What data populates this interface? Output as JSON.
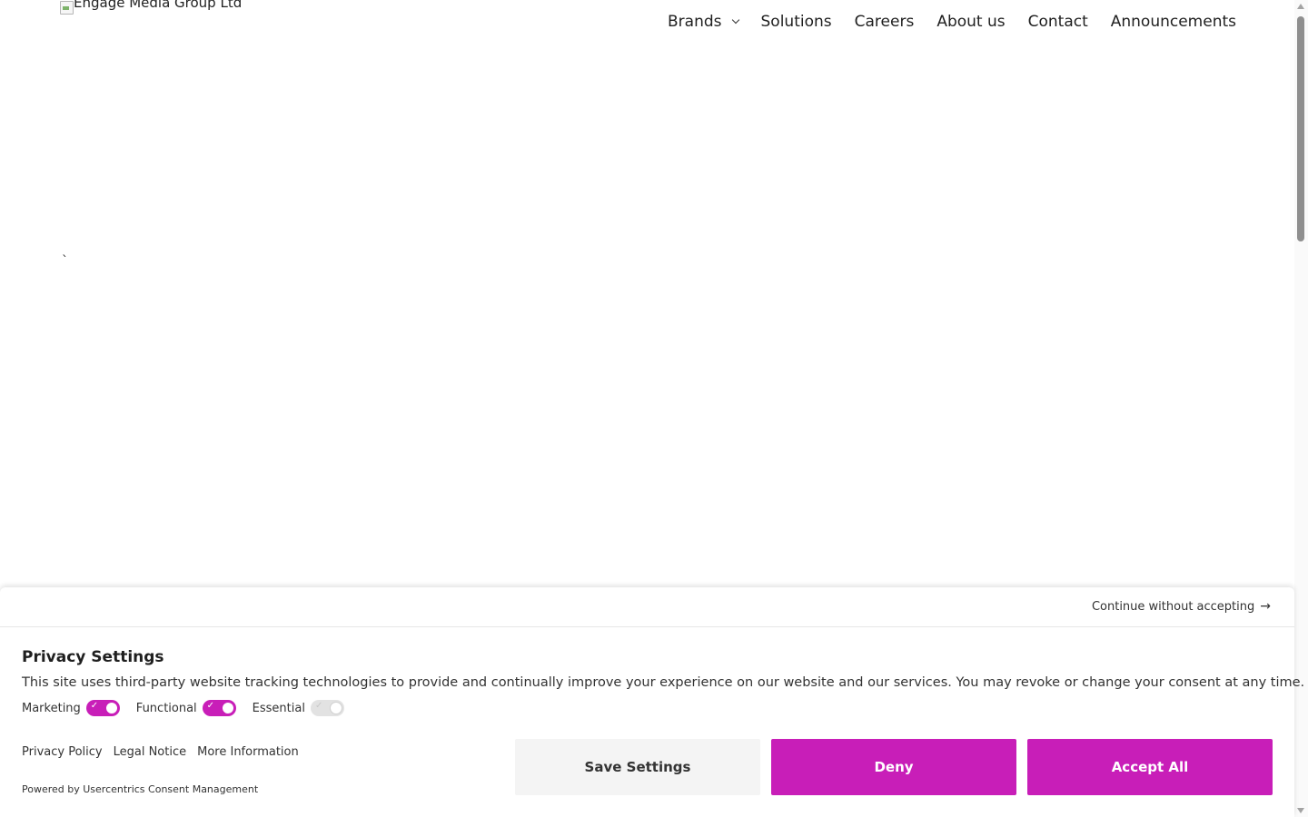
{
  "header": {
    "logo_alt": "Engage Media Group Ltd",
    "nav": [
      {
        "label": "Brands",
        "has_dropdown": true
      },
      {
        "label": "Solutions"
      },
      {
        "label": "Careers"
      },
      {
        "label": "About us"
      },
      {
        "label": "Contact"
      },
      {
        "label": "Announcements"
      }
    ]
  },
  "main": {
    "stray_char": "`"
  },
  "consent": {
    "continue_label": "Continue without accepting",
    "continue_icon": "arrow-right-icon",
    "title": "Privacy Settings",
    "description": "This site uses third-party website tracking technologies to provide and continually improve your experience on our website and our services. You may revoke or change your consent at any time.",
    "toggles": [
      {
        "label": "Marketing",
        "on": true
      },
      {
        "label": "Functional",
        "on": true
      },
      {
        "label": "Essential",
        "on": true,
        "disabled": true
      }
    ],
    "links": [
      "Privacy Policy",
      "Legal Notice",
      "More Information"
    ],
    "powered_by": "Powered by Usercentrics Consent Management",
    "buttons": {
      "save": "Save Settings",
      "deny": "Deny",
      "accept": "Accept All"
    },
    "accent_color": "#c81eb8"
  }
}
